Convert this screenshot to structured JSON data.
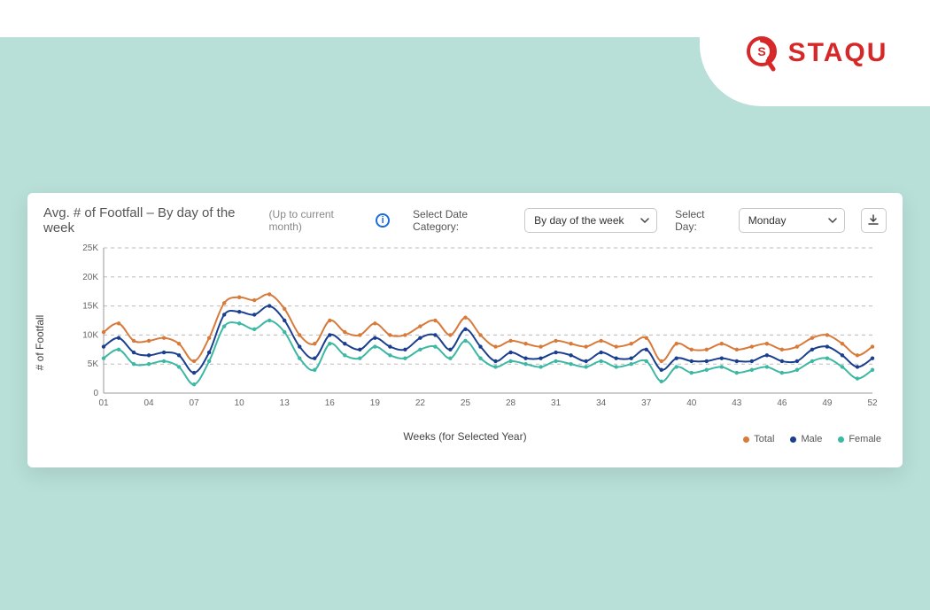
{
  "brand": {
    "name": "STAQU"
  },
  "header": {
    "title": "Avg. # of Footfall – By day of the week",
    "subtitle": "(Up to current month)",
    "info_glyph": "i"
  },
  "controls": {
    "date_category_label": "Select Date Category:",
    "date_category_value": "By day of the week",
    "day_label": "Select Day:",
    "day_value": "Monday"
  },
  "legend": {
    "total": "Total",
    "male": "Male",
    "female": "Female"
  },
  "colors": {
    "total": "#d77a3a",
    "male": "#1b3f8f",
    "female": "#3cb8a3",
    "grid": "#bbbbbb",
    "card_bg": "#ffffff",
    "page_bg": "#b8e0d8",
    "brand": "#d62828"
  },
  "chart_data": {
    "type": "line",
    "title": "Avg. # of Footfall – By day of the week",
    "xlabel": "Weeks (for Selected Year)",
    "ylabel": "# of Footfall",
    "ylim": [
      0,
      25000
    ],
    "yticks": [
      0,
      5000,
      10000,
      15000,
      20000,
      25000
    ],
    "ytick_labels": [
      "0",
      "5K",
      "10K",
      "15K",
      "20K",
      "25K"
    ],
    "x": [
      1,
      2,
      3,
      4,
      5,
      6,
      7,
      8,
      9,
      10,
      11,
      12,
      13,
      14,
      15,
      16,
      17,
      18,
      19,
      20,
      21,
      22,
      23,
      24,
      25,
      26,
      27,
      28,
      29,
      30,
      31,
      32,
      33,
      34,
      35,
      36,
      37,
      38,
      39,
      40,
      41,
      42,
      43,
      44,
      45,
      46,
      47,
      48,
      49,
      50,
      51,
      52
    ],
    "xtick_labels": [
      "01",
      "04",
      "07",
      "10",
      "13",
      "16",
      "19",
      "22",
      "25",
      "28",
      "31",
      "34",
      "37",
      "40",
      "43",
      "46",
      "49",
      "52"
    ],
    "xtick_positions": [
      1,
      4,
      7,
      10,
      13,
      16,
      19,
      22,
      25,
      28,
      31,
      34,
      37,
      40,
      43,
      46,
      49,
      52
    ],
    "series": [
      {
        "name": "Total",
        "color": "#d77a3a",
        "values": [
          10500,
          12000,
          9000,
          9000,
          9500,
          8500,
          5500,
          9500,
          15500,
          16500,
          16000,
          17000,
          14500,
          10000,
          8500,
          12500,
          10500,
          10000,
          12000,
          10000,
          10000,
          11500,
          12500,
          10000,
          13000,
          10000,
          8000,
          9000,
          8500,
          8000,
          9000,
          8500,
          8000,
          9000,
          8000,
          8500,
          9500,
          5500,
          8500,
          7500,
          7500,
          8500,
          7500,
          8000,
          8500,
          7500,
          8000,
          9500,
          10000,
          8500,
          6500,
          8000
        ]
      },
      {
        "name": "Male",
        "color": "#1b3f8f",
        "values": [
          8000,
          9500,
          7000,
          6500,
          7000,
          6500,
          3500,
          7000,
          13500,
          14000,
          13500,
          15000,
          12500,
          8000,
          6000,
          10000,
          8500,
          7500,
          9500,
          8000,
          7500,
          9500,
          10000,
          7500,
          11000,
          8000,
          5500,
          7000,
          6000,
          6000,
          7000,
          6500,
          5500,
          7000,
          6000,
          6000,
          7500,
          4000,
          6000,
          5500,
          5500,
          6000,
          5500,
          5500,
          6500,
          5500,
          5500,
          7500,
          8000,
          6500,
          4500,
          6000
        ]
      },
      {
        "name": "Female",
        "color": "#3cb8a3",
        "values": [
          6000,
          7500,
          5000,
          5000,
          5500,
          4500,
          1500,
          5500,
          11500,
          12000,
          11000,
          12500,
          10500,
          6000,
          4000,
          8500,
          6500,
          6000,
          8000,
          6500,
          6000,
          7500,
          8000,
          6000,
          9000,
          6000,
          4500,
          5500,
          5000,
          4500,
          5500,
          5000,
          4500,
          5500,
          4500,
          5000,
          5500,
          2000,
          4500,
          3500,
          4000,
          4500,
          3500,
          4000,
          4500,
          3500,
          4000,
          5500,
          6000,
          4500,
          2500,
          4000
        ]
      }
    ]
  }
}
